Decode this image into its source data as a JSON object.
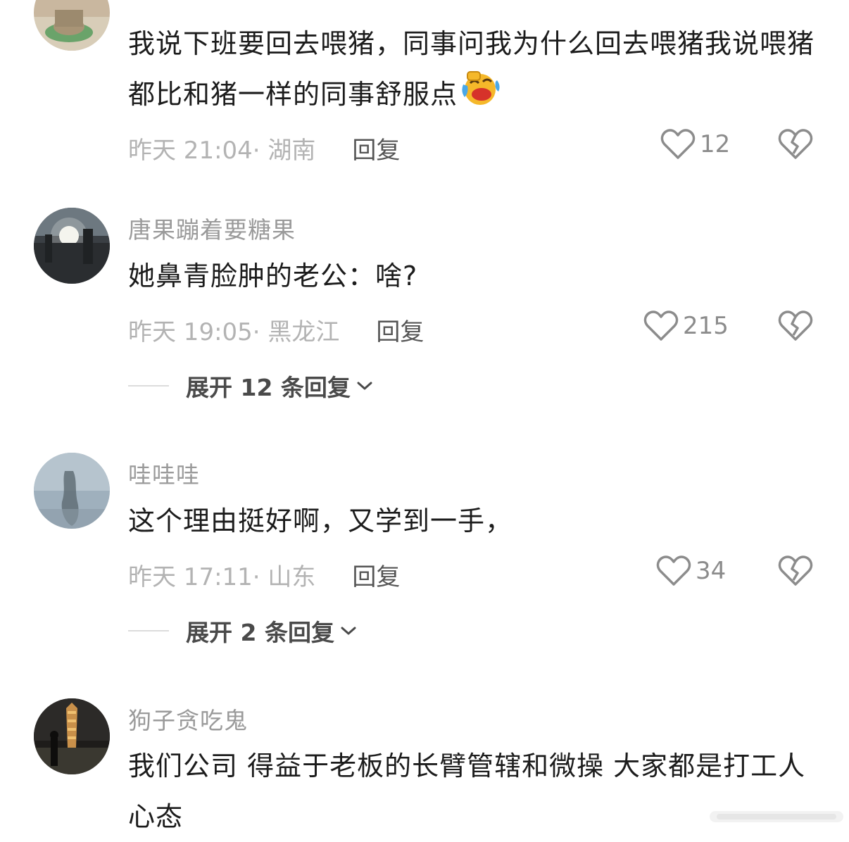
{
  "comments": [
    {
      "username": "",
      "text": "我说下班要回去喂猪，同事问我为什么回去喂猪我说喂猪都比和猪一样的同事舒服点",
      "emoji": "laughing-crying-emoji",
      "time": "昨天 21:04",
      "location": "· 湖南",
      "reply_label": "回复",
      "likes": "12"
    },
    {
      "username": "唐果蹦着要糖果",
      "text": "她鼻青脸肿的老公：啥?",
      "time": "昨天 19:05",
      "location": "· 黑龙江",
      "reply_label": "回复",
      "likes": "215",
      "expand_label": "展开 12 条回复"
    },
    {
      "username": "哇哇哇",
      "text": "这个理由挺好啊，又学到一手，",
      "time": "昨天 17:11",
      "location": "· 山东",
      "reply_label": "回复",
      "likes": "34",
      "expand_label": "展开 2 条回复"
    },
    {
      "username": "狗子贪吃鬼",
      "text": "我们公司 得益于老板的长臂管辖和微操 大家都是打工人心态"
    }
  ],
  "icons": {
    "like": "heart-outline-icon",
    "dislike": "broken-heart-icon",
    "expand": "chevron-down-icon"
  },
  "colors": {
    "meta_text": "#b3b3b3",
    "username": "#9a9a9a",
    "icon_gray": "#8c8c8c"
  }
}
